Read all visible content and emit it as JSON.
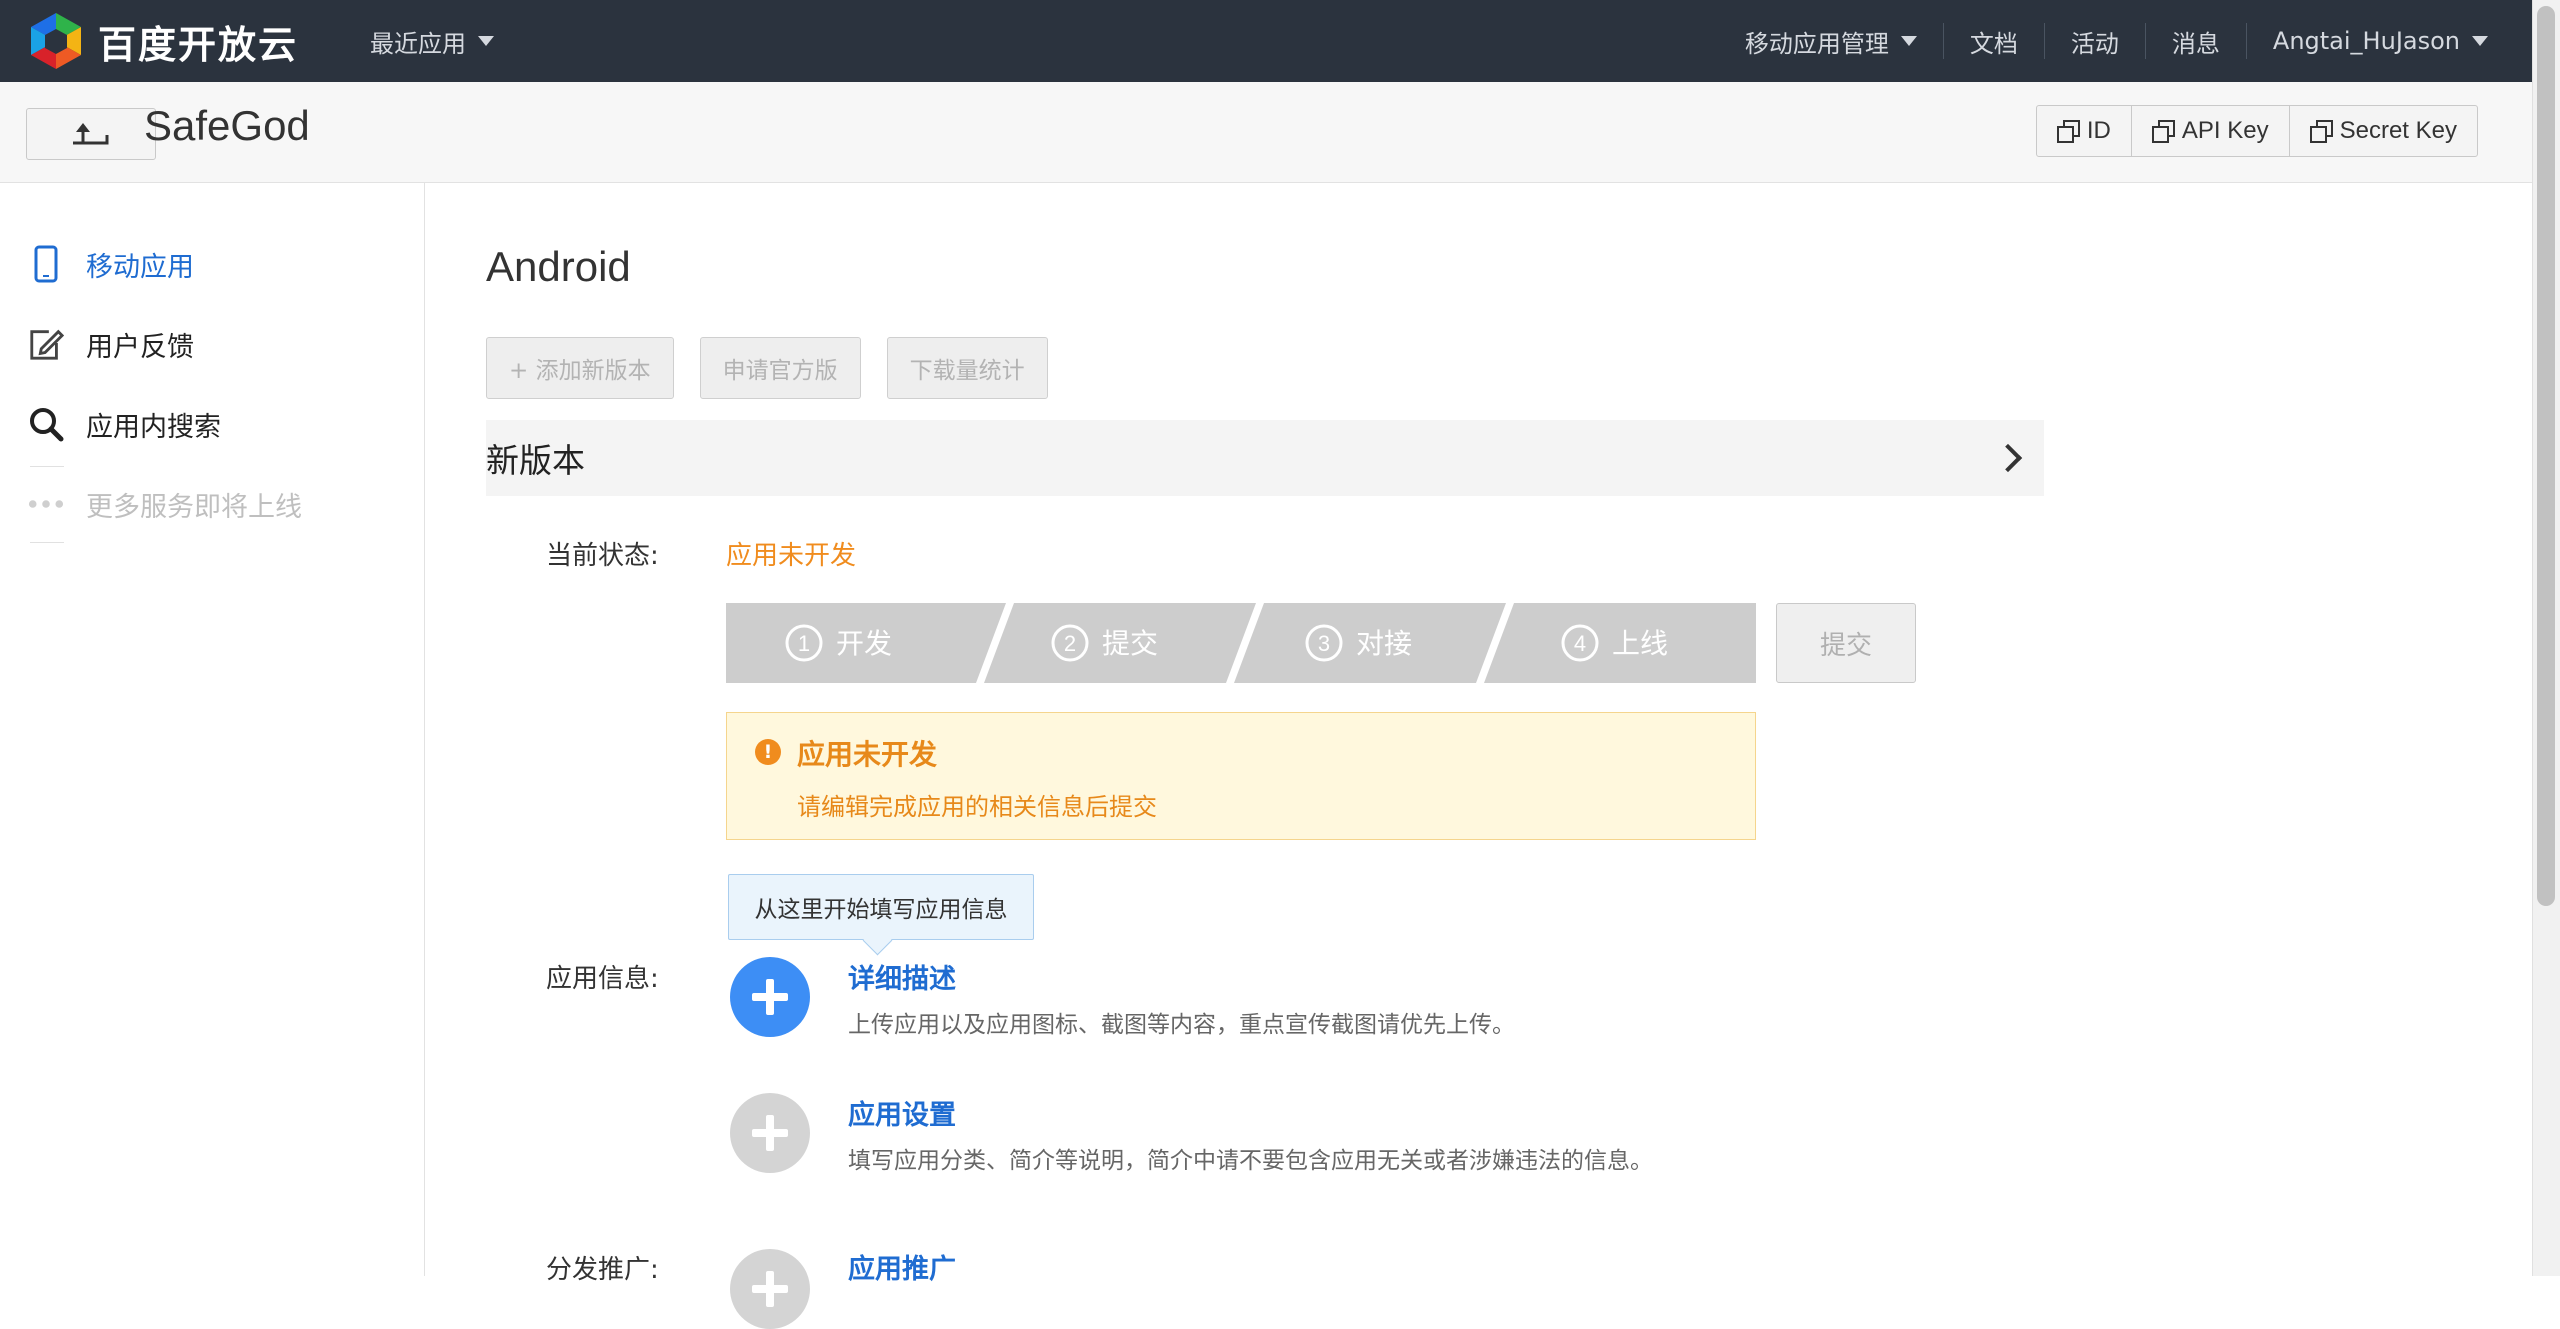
{
  "topnav": {
    "brand": "百度开放云",
    "recent_apps": "最近应用",
    "items": [
      "移动应用管理",
      "文档",
      "活动",
      "消息",
      "Angtai_HuJason"
    ],
    "bg_color": "#2b333e"
  },
  "appbar": {
    "app_name": "SafeGod",
    "back_icon": "return-arrow-icon",
    "keys": [
      "ID",
      "API Key",
      "Secret Key"
    ]
  },
  "sidebar": {
    "items": [
      {
        "label": "移动应用",
        "icon": "phone-icon",
        "state": "active"
      },
      {
        "label": "用户反馈",
        "icon": "edit-icon",
        "state": "normal"
      },
      {
        "label": "应用内搜索",
        "icon": "search-icon",
        "state": "normal"
      },
      {
        "label": "更多服务即将上线",
        "icon": "more-dots-icon",
        "state": "disabled"
      }
    ],
    "active_color": "#1f6cd1"
  },
  "main": {
    "platform": "Android",
    "buttons": [
      "+ 添加新版本",
      "申请官方版",
      "下载量统计"
    ],
    "section_title": "新版本",
    "status_label": "当前状态:",
    "status_value": "应用未开发",
    "status_color": "#f08c1e",
    "steps": [
      {
        "num": "1",
        "label": "开发"
      },
      {
        "num": "2",
        "label": "提交"
      },
      {
        "num": "3",
        "label": "对接"
      },
      {
        "num": "4",
        "label": "上线"
      }
    ],
    "submit_label": "提交",
    "alert": {
      "title": "应用未开发",
      "desc": "请编辑完成应用的相关信息后提交",
      "icon": "exclamation-circle-icon"
    },
    "tip": "从这里开始填写应用信息",
    "app_info_label": "应用信息:",
    "info_items": [
      {
        "title": "详细描述",
        "desc": "上传应用以及应用图标、截图等内容，重点宣传截图请优先上传。",
        "state": "active"
      },
      {
        "title": "应用设置",
        "desc": "填写应用分类、简介等说明，简介中请不要包含应用无关或者涉嫌违法的信息。",
        "state": "inactive"
      }
    ],
    "distribute_label": "分发推广:",
    "distribute_item": {
      "title": "应用推广"
    }
  }
}
